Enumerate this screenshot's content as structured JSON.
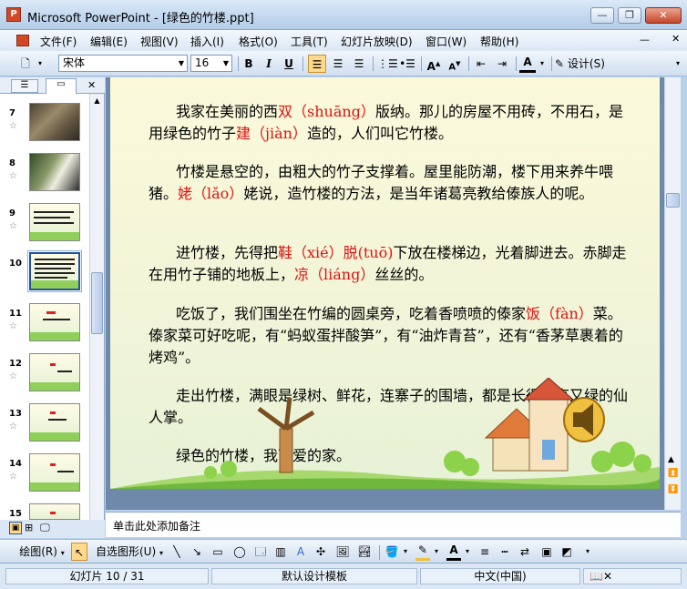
{
  "window": {
    "title": "Microsoft PowerPoint - [绿色的竹楼.ppt]",
    "minimize": "—",
    "restore": "❐",
    "close": "✕"
  },
  "menu": [
    "文件(F)",
    "编辑(E)",
    "视图(V)",
    "插入(I)",
    "格式(O)",
    "工具(T)",
    "幻灯片放映(D)",
    "窗口(W)",
    "帮助(H)"
  ],
  "toolbar": {
    "font": "宋体",
    "size": "16",
    "design": "设计(S)"
  },
  "slides": [
    {
      "num": "7"
    },
    {
      "num": "8"
    },
    {
      "num": "9"
    },
    {
      "num": "10"
    },
    {
      "num": "11"
    },
    {
      "num": "12"
    },
    {
      "num": "13"
    },
    {
      "num": "14"
    },
    {
      "num": "15"
    }
  ],
  "slide_text": {
    "p1": [
      {
        "t": "我家在美丽的西",
        "h": false
      },
      {
        "t": "双（shuāng）",
        "h": true
      },
      {
        "t": "版纳。那儿的房屋不用砖，不用石，是用绿色的竹子",
        "h": false
      },
      {
        "t": "建（jiàn）",
        "h": true
      },
      {
        "t": "造的，人们叫它竹楼。",
        "h": false
      }
    ],
    "p2": [
      {
        "t": "竹楼是悬空的，由粗大的竹子支撑着。屋里能防潮，楼下用来养牛喂猪。",
        "h": false
      },
      {
        "t": "姥（lǎo）",
        "h": true
      },
      {
        "t": "姥说，造竹楼的方法，是当年诸葛亮教给傣族人的呢。",
        "h": false
      }
    ],
    "p3": [
      {
        "t": "进竹楼，先得把",
        "h": false
      },
      {
        "t": "鞋（xié）脱(tuō)",
        "h": true
      },
      {
        "t": "下放在楼梯边，光着脚进去。赤脚走在用竹子铺的地板上，",
        "h": false
      },
      {
        "t": "凉（liáng）",
        "h": true
      },
      {
        "t": "丝丝的。",
        "h": false
      }
    ],
    "p4": [
      {
        "t": "吃饭了，我们围坐在竹编的圆桌旁，吃着香喷喷的傣家",
        "h": false
      },
      {
        "t": "饭（fàn）",
        "h": true
      },
      {
        "t": "菜。傣家菜可好吃呢，有“蚂蚁蛋拌酸笋”，有“油炸青苔”，还有“香茅草裹着的烤鸡”。",
        "h": false
      }
    ],
    "p5": [
      {
        "t": "走出竹楼，满眼是绿树、鲜花，连寨子的围墙，都是长得又高又绿的仙人掌。",
        "h": false
      }
    ],
    "p6": [
      {
        "t": "绿色的竹楼，我可爱的家。",
        "h": false
      }
    ]
  },
  "notes_placeholder": "单击此处添加备注",
  "draw": {
    "draw_menu": "绘图(R)",
    "autoshape": "自选图形(U)"
  },
  "status": {
    "slide": "幻灯片 10 / 31",
    "template": "默认设计模板",
    "lang": "中文(中国)"
  }
}
